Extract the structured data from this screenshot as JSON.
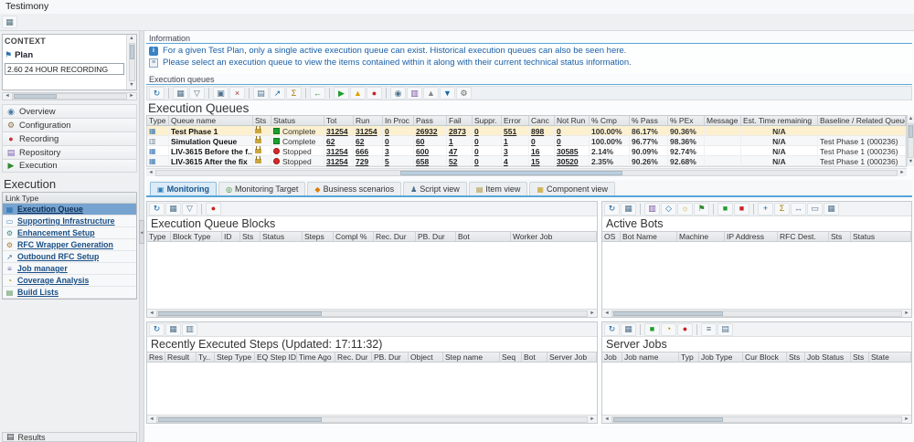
{
  "window": {
    "title": "Testimony"
  },
  "glyphs": {
    "left": "◄",
    "right": "►",
    "up": "▲",
    "down": "▼"
  },
  "app_toolbar": {
    "icons": [
      {
        "name": "window-grid",
        "glyph": "▦",
        "color": "#57717f"
      }
    ]
  },
  "context": {
    "title": "CONTEXT",
    "plan_icon_glyph": "⚑",
    "plan_label": "Plan",
    "plan_value": "2.60 24 HOUR RECORDING"
  },
  "nav": {
    "items": [
      {
        "key": "overview",
        "label": "Overview",
        "glyph": "◉",
        "color": "#4a7ba6"
      },
      {
        "key": "configuration",
        "label": "Configuration",
        "glyph": "⚙",
        "color": "#8a6d3b"
      },
      {
        "key": "recording",
        "label": "Recording",
        "glyph": "●",
        "color": "#c33333"
      },
      {
        "key": "repository",
        "label": "Repository",
        "glyph": "▤",
        "color": "#7a5ab0"
      },
      {
        "key": "execution",
        "label": "Execution",
        "glyph": "▶",
        "color": "#2e8b2e"
      }
    ]
  },
  "execution_nav": {
    "title": "Execution",
    "header": "Link Type",
    "items": [
      {
        "key": "execution-queue",
        "label": "Execution Queue",
        "glyph": "▦",
        "color": "#2a6fb0",
        "selected": true
      },
      {
        "key": "supporting-infrastructure",
        "label": "Supporting Infrastructure",
        "glyph": "▭",
        "color": "#4a8ac0"
      },
      {
        "key": "enhancement-setup",
        "label": "Enhancement Setup",
        "glyph": "⚙",
        "color": "#3a8a8a"
      },
      {
        "key": "rfc-wrapper-generation",
        "label": "RFC Wrapper Generation",
        "glyph": "⚙",
        "color": "#b07a2a"
      },
      {
        "key": "outbound-rfc-setup",
        "label": "Outbound RFC Setup",
        "glyph": "↗",
        "color": "#2a6fb0"
      },
      {
        "key": "job-manager",
        "label": "Job manager",
        "glyph": "≡",
        "color": "#7a5ab0"
      },
      {
        "key": "coverage-analysis",
        "label": "Coverage Analysis",
        "glyph": "◔",
        "color": "#b58900"
      },
      {
        "key": "build-lists",
        "label": "Build Lists",
        "glyph": "▤",
        "color": "#4a8a4a"
      }
    ]
  },
  "results_section": {
    "label": "Results",
    "glyph": "▤"
  },
  "information": {
    "title": "Information",
    "lines": [
      {
        "icon": "info",
        "text": "For a given Test Plan, only a single active execution queue can exist. Historical execution queues can also be seen here."
      },
      {
        "icon": "note",
        "text": "Please select an execution queue to view the items contained within it along with their current technical status information."
      }
    ]
  },
  "queues_section": {
    "header": "Execution queues",
    "title": "Execution Queues",
    "toolbar": [
      {
        "name": "refresh",
        "glyph": "↻",
        "color": "#1667a8"
      },
      {
        "sep": true
      },
      {
        "name": "choose-layout",
        "glyph": "▦",
        "color": "#51718c"
      },
      {
        "name": "filter",
        "glyph": "▽",
        "color": "#51718c"
      },
      {
        "sep": true
      },
      {
        "name": "copy",
        "glyph": "▣",
        "color": "#51718c"
      },
      {
        "name": "delete",
        "glyph": "×",
        "color": "#a33333"
      },
      {
        "sep": true
      },
      {
        "name": "print",
        "glyph": "▤",
        "color": "#51718c"
      },
      {
        "name": "export",
        "glyph": "↗",
        "color": "#1667a8"
      },
      {
        "name": "sum",
        "glyph": "Σ",
        "color": "#a87b00"
      },
      {
        "sep": true
      },
      {
        "name": "back",
        "glyph": "←",
        "color": "#2e8b2e"
      },
      {
        "sep": true
      },
      {
        "name": "start",
        "glyph": "▶",
        "color": "#1f9d2f"
      },
      {
        "name": "suspend",
        "glyph": "▲",
        "color": "#e0a100"
      },
      {
        "name": "stop",
        "glyph": "●",
        "color": "#cc2222"
      },
      {
        "sep": true
      },
      {
        "name": "details",
        "glyph": "◉",
        "color": "#51718c"
      },
      {
        "name": "chart",
        "glyph": "▥",
        "color": "#7a4da0"
      },
      {
        "name": "upload",
        "glyph": "▲",
        "color": "#888888"
      },
      {
        "name": "download",
        "glyph": "▼",
        "color": "#1667a8"
      },
      {
        "name": "settings",
        "glyph": "⚙",
        "color": "#666666"
      }
    ],
    "columns": [
      "Type",
      "Queue name",
      "Sts",
      "Status",
      "Tot",
      "Run",
      "In Proc",
      "Pass",
      "Fail",
      "Suppr.",
      "Error",
      "Canc",
      "Not Run",
      "% Cmp",
      "% Pass",
      "% PEx",
      "Message",
      "Est. Time remaining",
      "Baseline / Related Queue"
    ],
    "rows": [
      {
        "key": "test-phase-1",
        "type_icon": "queue",
        "type_glyph": "▦",
        "type_color": "#3c78b4",
        "name": "Test Phase 1",
        "lock": "locked",
        "light": "green",
        "status": "Complete",
        "nums": [
          "31254",
          "31254",
          "0",
          "26932",
          "2873",
          "0",
          "551",
          "898",
          "0"
        ],
        "pcts": [
          "100.00%",
          "86.17%",
          "90.36%"
        ],
        "message": "",
        "est_time": "N/A",
        "baseline": "",
        "selected": true
      },
      {
        "key": "simulation-queue",
        "type_icon": "simulation",
        "type_glyph": "▥",
        "type_color": "#7a8ca0",
        "name": "Simulation Queue",
        "lock": "locked",
        "light": "green",
        "status": "Complete",
        "nums": [
          "62",
          "62",
          "0",
          "60",
          "1",
          "0",
          "1",
          "0",
          "0"
        ],
        "pcts": [
          "100.00%",
          "96.77%",
          "98.36%"
        ],
        "message": "",
        "est_time": "N/A",
        "baseline": "Test Phase 1 (000236)",
        "selected": false
      },
      {
        "key": "liv-3615-before",
        "type_icon": "queue",
        "type_glyph": "▦",
        "type_color": "#3c78b4",
        "name": "LIV-3615 Before the f..",
        "lock": "locked",
        "light": "red",
        "status": "Stopped",
        "nums": [
          "31254",
          "666",
          "3",
          "600",
          "47",
          "0",
          "3",
          "16",
          "30585"
        ],
        "pcts": [
          "2.14%",
          "90.09%",
          "92.74%"
        ],
        "message": "",
        "est_time": "N/A",
        "baseline": "Test Phase 1 (000236)",
        "selected": false
      },
      {
        "key": "liv-3615-after",
        "type_icon": "queue",
        "type_glyph": "▦",
        "type_color": "#3c78b4",
        "name": "LIV-3615 After the fix",
        "lock": "locked",
        "light": "red",
        "status": "Stopped",
        "nums": [
          "31254",
          "729",
          "5",
          "658",
          "52",
          "0",
          "4",
          "15",
          "30520"
        ],
        "pcts": [
          "2.35%",
          "90.26%",
          "92.68%"
        ],
        "message": "",
        "est_time": "N/A",
        "baseline": "Test Phase 1 (000236)",
        "selected": false
      }
    ]
  },
  "tabs": [
    {
      "key": "monitoring",
      "label": "Monitoring",
      "glyph": "▣",
      "color": "#2a7fc0",
      "active": true
    },
    {
      "key": "monitoring-target",
      "label": "Monitoring Target",
      "glyph": "◎",
      "color": "#2e8b2e",
      "active": false
    },
    {
      "key": "business-scenarios",
      "label": "Business scenarios",
      "glyph": "◆",
      "color": "#e07b00",
      "active": false
    },
    {
      "key": "script-view",
      "label": "Script view",
      "glyph": "♟",
      "color": "#4a6b8a",
      "active": false
    },
    {
      "key": "item-view",
      "label": "Item view",
      "glyph": "▤",
      "color": "#a8892a",
      "active": false
    },
    {
      "key": "component-view",
      "label": "Component view",
      "glyph": "▦",
      "color": "#c9a227",
      "active": false
    }
  ],
  "panels": {
    "blocks": {
      "title": "Execution Queue Blocks",
      "toolbar": [
        {
          "name": "refresh",
          "glyph": "↻",
          "color": "#1667a8"
        },
        {
          "name": "choose-layout",
          "glyph": "▦",
          "color": "#51718c"
        },
        {
          "name": "filter",
          "glyph": "▽",
          "color": "#51718c"
        },
        {
          "sep": true
        },
        {
          "name": "stop",
          "glyph": "●",
          "color": "#cc2222"
        }
      ],
      "columns": [
        "Type",
        "Block Type",
        "ID",
        "Sts",
        "Status",
        "Steps",
        "Compl %",
        "Rec. Dur",
        "PB. Dur",
        "Bot",
        "Worker Job"
      ]
    },
    "bots": {
      "title": "Active Bots",
      "toolbar": [
        {
          "name": "refresh",
          "glyph": "↻",
          "color": "#1667a8"
        },
        {
          "name": "choose-layout",
          "glyph": "▦",
          "color": "#51718c"
        },
        {
          "sep": true
        },
        {
          "name": "chart",
          "glyph": "▥",
          "color": "#7a4da0"
        },
        {
          "name": "edit",
          "glyph": "◇",
          "color": "#1667a8"
        },
        {
          "name": "hint",
          "glyph": "☼",
          "color": "#c9a227"
        },
        {
          "name": "flag",
          "glyph": "⚑",
          "color": "#2e8b2e"
        },
        {
          "sep": true
        },
        {
          "name": "start-bot",
          "glyph": "■",
          "color": "#1f9d2f"
        },
        {
          "name": "stop-bot",
          "glyph": "■",
          "color": "#cc2222"
        },
        {
          "sep": true
        },
        {
          "name": "add",
          "glyph": "+",
          "color": "#1667a8"
        },
        {
          "name": "sum",
          "glyph": "Σ",
          "color": "#a87b00"
        },
        {
          "name": "transfer",
          "glyph": "↔",
          "color": "#51718c"
        },
        {
          "name": "monitor",
          "glyph": "▭",
          "color": "#51718c"
        },
        {
          "name": "grid",
          "glyph": "▦",
          "color": "#51718c"
        }
      ],
      "columns": [
        "OS",
        "Bot Name",
        "Machine",
        "IP Address",
        "RFC Dest.",
        "Sts",
        "Status"
      ]
    },
    "recent": {
      "title": "Recently Executed Steps (Updated: 17:11:32)",
      "toolbar": [
        {
          "name": "refresh",
          "glyph": "↻",
          "color": "#1667a8"
        },
        {
          "name": "choose-layout",
          "glyph": "▦",
          "color": "#51718c"
        },
        {
          "name": "chart",
          "glyph": "▥",
          "color": "#51718c"
        }
      ],
      "columns": [
        "Res",
        "Result",
        "Ty..",
        "Step Type",
        "EQ Step ID",
        "Time Ago",
        "Rec. Dur",
        "PB. Dur",
        "Object",
        "Step name",
        "Seq",
        "Bot",
        "Server Job"
      ]
    },
    "jobs": {
      "title": "Server Jobs",
      "toolbar": [
        {
          "name": "refresh",
          "glyph": "↻",
          "color": "#1667a8"
        },
        {
          "name": "choose-layout",
          "glyph": "▦",
          "color": "#51718c"
        },
        {
          "sep": true
        },
        {
          "name": "release",
          "glyph": "■",
          "color": "#1f9d2f"
        },
        {
          "name": "schedule",
          "glyph": "◔",
          "color": "#a87b00"
        },
        {
          "name": "cancel",
          "glyph": "●",
          "color": "#cc2222"
        },
        {
          "sep": true
        },
        {
          "name": "list",
          "glyph": "≡",
          "color": "#51718c"
        },
        {
          "name": "grid",
          "glyph": "▤",
          "color": "#51718c"
        }
      ],
      "columns": [
        "Job",
        "Job name",
        "Typ",
        "Job Type",
        "Cur Block",
        "Sts",
        "Job Status",
        "Sts",
        "State"
      ]
    }
  }
}
